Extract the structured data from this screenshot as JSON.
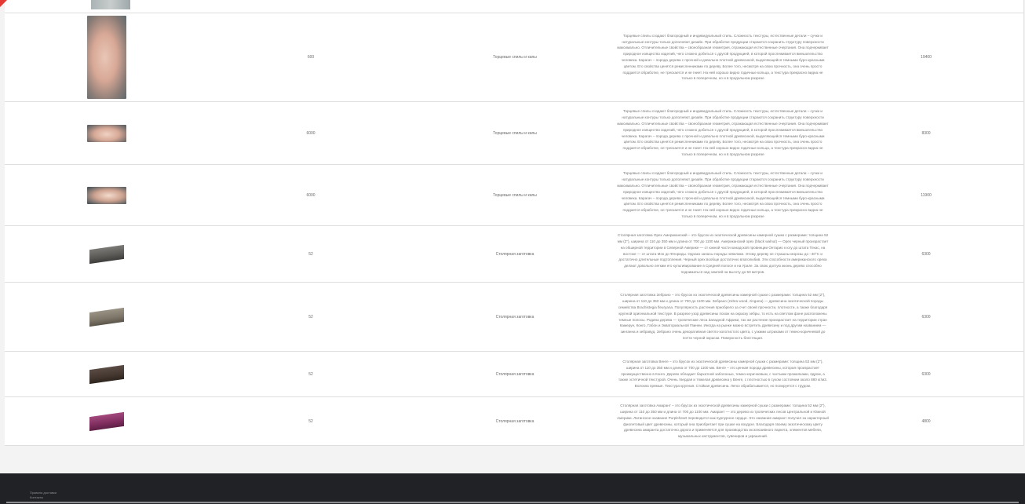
{
  "rows": [
    {
      "qty": "600",
      "name": "Торцевые спилы и капы",
      "price": "19400",
      "image": "rock-burl-tall",
      "desc": "Торцевые спилы создают благородный и индивидуальный стиль. Сложность текстуры, естественные детали – сучки и натуральные контуры только дополняют дизайн. При обработке продукции стараются сохранить структуру поверхности максимально. Отличительные свойства – своеобразная геометрия, отражающая естественные очертания. Она подчеркивает природное изящество изделий, чего сложно добиться с другой продукцией, в которой прослеживается вмешательство человека. Карагач – порода дерева с прочной и довольно плотной древесиной, выделяющейся темными буро-красными цветом. Его свойства ценятся ремесленниками по дереву. Более того, несмотря на свою прочность, она очень просто поддается обработке, не трескается и не гниет. На ней хорошо видно годичные кольца, а текстура прекрасно видна не только в поперечном, но и в продольном разрезе"
    },
    {
      "qty": "6000",
      "name": "Торцевые спилы и капы",
      "price": "8300",
      "image": "rock-burl-wide",
      "desc": "Торцевые спилы создают благородный и индивидуальный стиль. Сложность текстуры, естественные детали – сучки и натуральные контуры только дополняют дизайн. При обработке продукции стараются сохранить структуру поверхности максимально. Отличительные свойства – своеобразная геометрия, отражающая естественные очертания. Она подчеркивает природное изящество изделий, чего сложно добиться с другой продукцией, в которой прослеживается вмешательство человека. Карагач – порода дерева с прочной и довольно плотной древесиной, выделяющейся темными буро-красными цветом. Его свойства ценятся ремесленниками по дереву. Более того, несмотря на свою прочность, она очень просто поддается обработке, не трескается и не гниет. На ней хорошо видно годичные кольца, а текстура прекрасно видна не только в поперечном, но и в продольном разрезе"
    },
    {
      "qty": "6000",
      "name": "Торцевые спилы и капы",
      "price": "11900",
      "image": "rock-burl-wide",
      "desc": "Торцевые спилы создают благородный и индивидуальный стиль. Сложность текстуры, естественные детали – сучки и натуральные контуры только дополняют дизайн. При обработке продукции стараются сохранить структуру поверхности максимально. Отличительные свойства – своеобразная геометрия, отражающая естественные очертания. Она подчеркивает природное изящество изделий, чего сложно добиться с другой продукцией, в которой прослеживается вмешательство человека. Карагач – порода дерева с прочной и довольно плотной древесиной, выделяющейся темными буро-красными цветом. Его свойства ценятся ремесленниками по дереву. Более того, несмотря на свою прочность, она очень просто поддается обработке, не трескается и не гниет. На ней хорошо видно годичные кольца, а текстура прекрасно видна не только в поперечном, но и в продольном разрезе"
    },
    {
      "qty": "52",
      "name": "Столярная заготовка",
      "price": "6300",
      "image": "plank-grey",
      "desc": "Столярная заготовка Орех Американский – это брусок из экзотической древесины камерной сушки с размерами: толщина 52 мм (2\"), ширина от 110 до 350 мм и длина от 700 до 1100 мм. Американский орех (black walnut) — Орех черный произрастает на обширной территории в Северной Америке — от южной части канадской провинции Онтарио к югу до штата Техас, на востоке — от штата Мэн до Флориды. Однако запасы породы невелики. Этому дереву не страшны морозы до –40°С и достаточно длительные подтопления. Черный орех вообще достаточно влаголюбив. Эти способности американского ореха делают довольно легким его культивирование в Средней полосе и на Урале. За свою долгую жизнь дерево способно подниматься над землей на высоту до 50 метров."
    },
    {
      "qty": "52",
      "name": "Столярная заготовка",
      "price": "6300",
      "image": "plank-zebrano",
      "desc": "Столярная заготовка Зебрано – это брусок из экзотической древесины камерной сушки с размерами: толщина 52 мм (2\"), ширина от 110 до 350 мм и длина от 700 до 1100 мм. Зебрано (zebra wood, zingana) — древесина экзотической породы семейства Brachistegia fleuryana. Популярность растения приобрело за счет своей прочности, плотности, а также благодаря крупной оригинальной текстуре. В разрезе узор древесины похож на окраску зебры, то есть на светлом фоне расположены темные полосы. Родина дерева — тропические леса Западной Африки, так же растение произрастает на территории стран Камерун, Конго, Габон и Экваториальной Гвинеи. Иногда на рынке можно встретить древесину и под другим названием — зинганна и зебравуд. Зебрано очень декоративная светло-золотистого цвета, с узкими штрихами от темно-коричневой до почти черной окраски. Поверхность блестящая."
    },
    {
      "qty": "52",
      "name": "Столярная заготовка",
      "price": "6300",
      "image": "plank-wenge",
      "desc": "Столярная заготовка Венге – это брусок из экзотической древесины камерной сушки с размерами: толщина 52 мм (2\"), ширина от 110 до 350 мм и длина от 700 до 1100 мм. Венге – это ценная порода древесины, которая произрастает преимущественно в Конго. Дерево обладает бархатной заболонью, темно-коричневым, с частыми прожилками, ядром, а также эстетичной текстурой. Очень твердая и тяжелая древесина у Венге, с плотностью в сухом состоянии около 880 кг/м3. Волокна прямые. Текстура крупная. Стойкая древесина. Легко обрабатывается, но полируется с трудом."
    },
    {
      "qty": "52",
      "name": "Столярная заготовка",
      "price": "4800",
      "image": "plank-amaranth",
      "desc": "Столярная заготовка Амарант – это брусок из экзотической древесины камерной сушки с размерами: толщина 52 мм (2\"), ширина от 110 до 350 мм и длина от 700 до 1100 мм. Амарант — это дерево из тропических лесов Центральной и Южной Америки. Латинское название Purpleheart переводится как пурпурное сердце. Это название амарант получил за характерный фиолетовый цвет древесины, который она приобретает при сушке на воздухе. Благодаря своему экзотическому цвету древесина амаранта достаточно дорога и применяется для производства эксклюзивного паркета, элементов мебели, музыкальных инструментов, сувениров и украшений."
    }
  ],
  "footer": {
    "link1": "Правила доставки",
    "link2": "Контакты"
  }
}
